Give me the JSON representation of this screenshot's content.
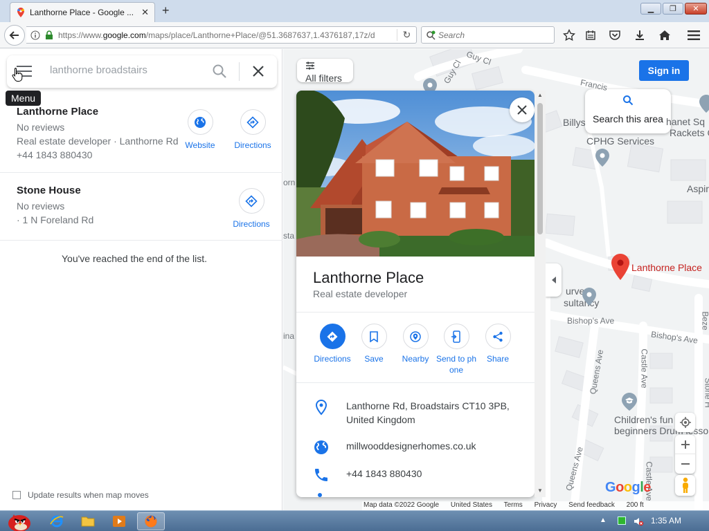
{
  "browser": {
    "tab_title": "Lanthorne Place - Google ...",
    "url_prefix": "https://www.",
    "url_domain": "google.com",
    "url_rest": "/maps/place/Lanthorne+Place/@51.3687637,1.4376187,17z/d",
    "search_placeholder": "Search"
  },
  "left": {
    "search_value": "lanthorne broadstairs",
    "menu_tooltip": "Menu",
    "results": [
      {
        "name": "Lanthorne Place",
        "reviews": "No reviews",
        "detail": "Real estate developer · Lanthorne Rd",
        "phone": "+44 1843 880430",
        "website_label": "Website",
        "directions_label": "Directions"
      },
      {
        "name": "Stone House",
        "reviews": "No reviews",
        "detail": "· 1 N Foreland Rd",
        "directions_label": "Directions"
      }
    ],
    "end_text": "You've reached the end of the list.",
    "update_label": "Update results when map moves"
  },
  "map": {
    "filters_label": "All filters",
    "signin_label": "Sign in",
    "search_area_label": "Search this area",
    "labels": {
      "guy_cl_1": "Guy Cl",
      "guy_cl_2": "Guy Cl",
      "francis": "Francis",
      "billys": "Billys",
      "thanet": "hanet Sq",
      "rackets": "Rackets C",
      "cphg": "CPHG Services",
      "aspire": "Aspire",
      "lanthorne_pin": "Lanthorne Place",
      "survey1": "urvey",
      "survey2": "sultancy",
      "bishops1": "Bishop's Ave",
      "bishops2": "Bishop's Ave",
      "queens": "Queens Ave",
      "castle": "Castle Ave",
      "castle2": "Castle Ave",
      "childrens1": "Children's fun",
      "childrens2": "beginners Drum lesso",
      "queens2": "Queens Ave",
      "stone": "Stone H",
      "orn": "orn",
      "sta": "sta",
      "ina": "ina",
      "beze": "Beze"
    },
    "google": "Google",
    "attribution": [
      "Map data ©2022 Google",
      "United States",
      "Terms",
      "Privacy",
      "Send feedback",
      "200 ft"
    ]
  },
  "card": {
    "title": "Lanthorne Place",
    "subtitle": "Real estate developer",
    "actions": [
      "Directions",
      "Save",
      "Nearby",
      "Send to ph one",
      "Share"
    ],
    "address_line1": "Lanthorne Rd, Broadstairs CT10 3PB,",
    "address_line2": "United Kingdom",
    "website": "millwooddesignerhomes.co.uk",
    "phone": "+44 1843 880430"
  },
  "taskbar": {
    "clock": "1:35 AM"
  },
  "colors": {
    "accent": "#1a73e8",
    "pin": "#ea4335"
  }
}
